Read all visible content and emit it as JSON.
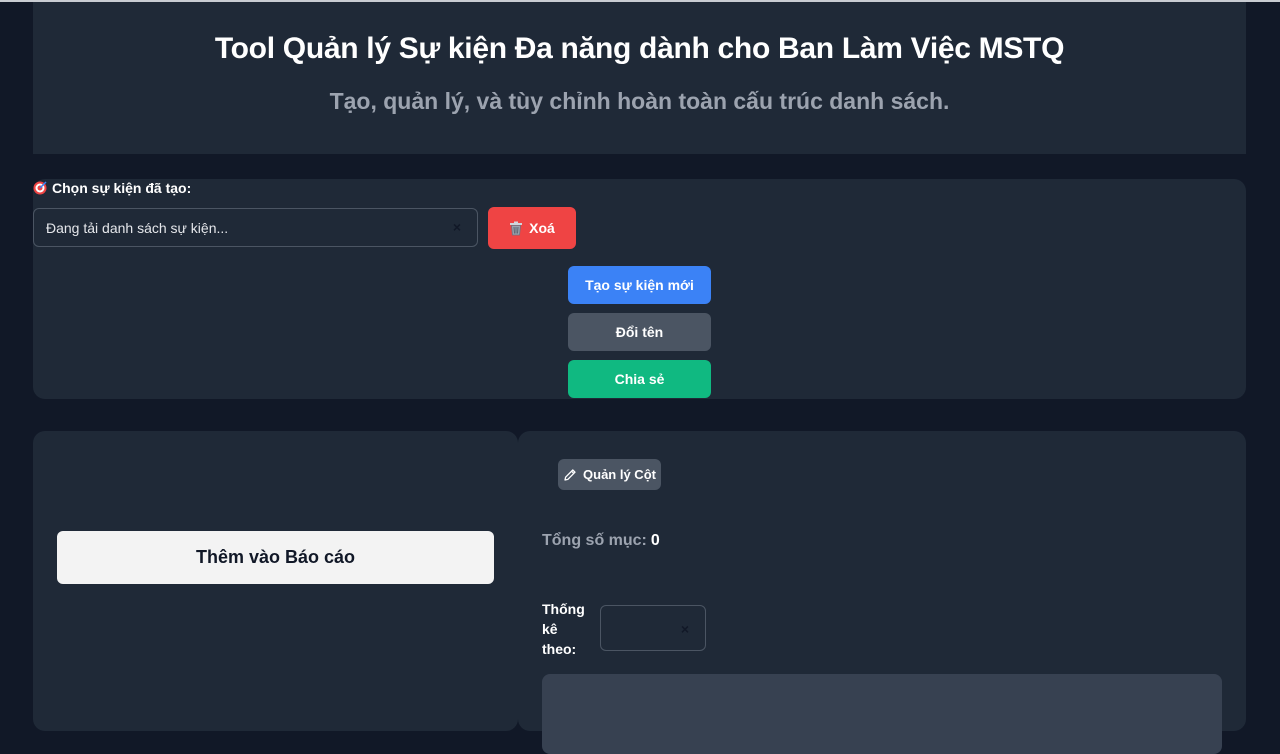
{
  "header": {
    "title": "Tool Quản lý Sự kiện Đa năng dành cho Ban Làm Việc MSTQ",
    "subtitle": "Tạo, quản lý, và tùy chỉnh hoàn toàn cấu trúc danh sách."
  },
  "event_selector": {
    "label": "Chọn sự kiện đã tạo:",
    "value": "Đang tải danh sách sự kiện...",
    "clear": "×",
    "delete_label": "Xoá"
  },
  "actions": {
    "new_event": "Tạo sự kiện mới",
    "rename": "Đổi tên",
    "share": "Chia sẻ"
  },
  "left_panel": {
    "add_report": "Thêm vào Báo cáo"
  },
  "right_panel": {
    "manage_columns": "Quản lý Cột",
    "total_label": "Tổng số mục:",
    "total_value": "0",
    "stat_by_label": "Thống kê theo:",
    "stat_clear": "×"
  },
  "icons": {
    "target": "target-icon",
    "trash": "trash-icon",
    "pencil": "pencil-icon"
  },
  "colors": {
    "background": "#111827",
    "panel": "#1f2937",
    "primary": "#3b82f6",
    "danger": "#ef4444",
    "success": "#10b981",
    "neutral": "#4b5563"
  }
}
